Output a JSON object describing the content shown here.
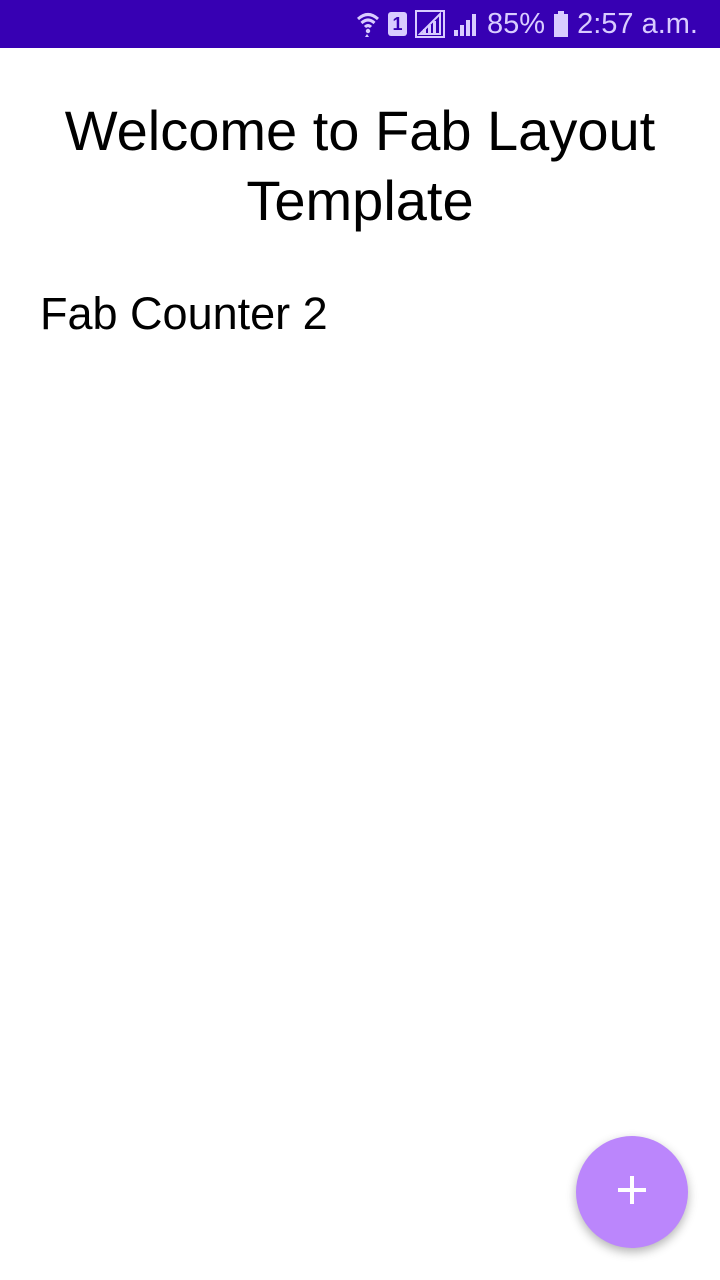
{
  "status_bar": {
    "battery": "85%",
    "time": "2:57 a.m.",
    "sim_label": "1",
    "icons": [
      "wifi-icon",
      "sim-icon",
      "signal-1-icon",
      "signal-2-icon",
      "battery-icon"
    ],
    "background_color": "#3700b3"
  },
  "main": {
    "title": "Welcome to Fab Layout Template",
    "counter_label": "Fab Counter 2"
  },
  "fab": {
    "icon": "plus-icon",
    "color": "#bb86fc"
  }
}
